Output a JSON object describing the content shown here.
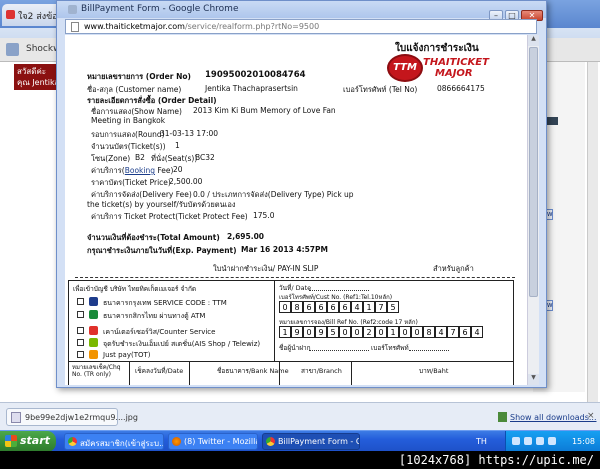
{
  "background_browser": {
    "tab_title": "ใจ2 ส่งข้อความ",
    "infobar_text": "Shockwave",
    "left_block_line1": "สวัสดีค่ะ",
    "left_block_line2": "คุณ Jentika",
    "view_label": "View"
  },
  "popup": {
    "window_title": "BillPayment Form - Google Chrome",
    "url_host": "www.thaiticketmajor.com",
    "url_path": "/service/realform.php?rtNo=9500",
    "minimize": "–",
    "maximize": "□",
    "close": "✕"
  },
  "receipt": {
    "heading": "ใบแจ้งการชำระเงิน",
    "logo_mark": "TTM",
    "logo_line1": "THAITICKET",
    "logo_line2": "MAJOR",
    "order_no_label": "หมายเลขรายการ (Order No)",
    "order_no": "19095002010084764",
    "customer_label": "ชื่อ-สกุล (Customer name)",
    "customer_name": "Jentika Thachaprasertsin",
    "tel_label": "เบอร์โทรศัพท์ (Tel No)",
    "tel": "0866664175",
    "detail_heading": "รายละเอียดการสั่งซื้อ (Order Detail)",
    "show_name_label": "ชื่อการแสดง(Show Name)",
    "show_name_line1": "2013 Kim Ki Bum Memory of Love Fan",
    "show_name_line2": "Meeting in Bangkok",
    "round_label": "รอบการแสดง(Round)",
    "round": "31-03-13 17:00",
    "ticket_count_label": "จำนวนบัตร(Ticket(s))",
    "ticket_count": "1",
    "zone_label": "โซน(Zone)",
    "zone": "B2",
    "seat_label": "ที่นั่ง(Seat(s))",
    "seat": "BC32",
    "booking_fee_label_a": "ค่าบริการ(",
    "booking_fee_link": "Booking",
    "booking_fee_label_b": " Fee)",
    "booking_fee": "20",
    "ticket_price_label": "ราคาบัตร(Ticket Price)",
    "ticket_price": "2,500.00",
    "delivery_fee_label": "ค่าบริการจัดส่ง(Delivery Fee)",
    "delivery_fee_value": "0.0 / ประเภทการจัดส่ง(Delivery Type)  Pick up",
    "delivery_note": "the ticket(s) by yourself/รับบัตรด้วยตนเอง",
    "protect_label": "ค่าบริการ Ticket Protect(Ticket Protect Fee)",
    "protect_fee": "175.0",
    "total_label": "จำนวนเงินที่ต้องชำระ(Total Amount)",
    "total": "2,695.00",
    "expiry_label": "กรุณาชำระเงินภายในวันที่(Exp. Payment)",
    "expiry": "Mar 16 2013 4:57PM",
    "slip_title": "ใบนำฝากชำระเงิน/ PAY-IN SLIP",
    "slip_right": "สำหรับลูกค้า",
    "slip_for": "เพื่อเข้าบัญชี บริษัท ไทยทิคเก็ตเมเจอร์ จำกัด",
    "bank1": "ธนาคารกรุงเทพ SERVICE CODE : TTM",
    "bank2": "ธนาคารกสิกรไทย ผ่านทางตู้ ATM",
    "counter1": "เคาน์เตอร์เซอร์วิส/Counter Service",
    "counter2": "จุดรับชำระเงินเอ็มเปย์ สเตชั่น(AIS Shop / Telewiz)",
    "counter3": "Just pay(TOT)",
    "date_label": "วันที่/ Date",
    "cust_no_label": "เบอร์โทรศัพท์/Cust No. (Ref1:Tel.10หลัก)",
    "cust_digits": [
      "0",
      "8",
      "6",
      "6",
      "6",
      "6",
      "4",
      "1",
      "7",
      "5"
    ],
    "bill_ref_label": "หมายเลขการจอง/Bill Ref No. (Ref2:code 17 หลัก)",
    "bill_digits": [
      "1",
      "9",
      "0",
      "9",
      "5",
      "0",
      "0",
      "2",
      "0",
      "1",
      "0",
      "0",
      "8",
      "4",
      "7",
      "6",
      "4"
    ],
    "payer_label": "ชื่อผู้นำฝาก",
    "payer_tel_label": "เบอร์โทรศัพท์",
    "col_cheque": "หมายเลขเช็ค/Chq No. (TR only)",
    "col_date": "เช็คลงวันที่/Date",
    "col_bank": "ชื่อธนาคาร/Bank Name",
    "col_branch": "สาขา/Branch",
    "col_amount": "บาท/Baht"
  },
  "download_bar": {
    "file": "9be99e2djw1e2rmqu9....jpg",
    "show_all": "Show all downloads...",
    "close": "×"
  },
  "taskbar": {
    "start": "start",
    "tasks": [
      "สมัครสมาชิก(เข้าสู่ระบ...",
      "(8) Twitter - Mozilla Fi...",
      "BillPayment Form - Go..."
    ],
    "lang": "TH",
    "clock": "15:08"
  },
  "watermark": "[1024x768] https://upic.me/"
}
